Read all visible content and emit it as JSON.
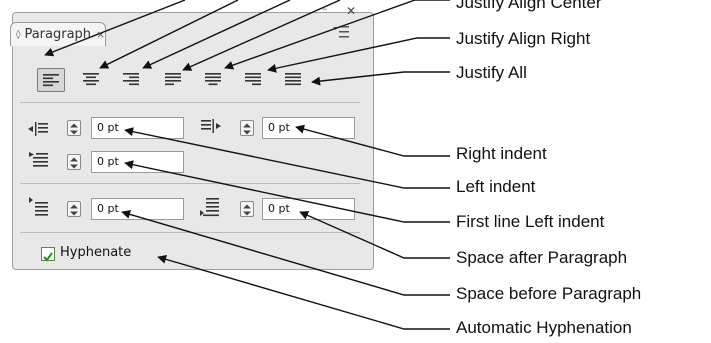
{
  "panel": {
    "tab_label": "Paragraph",
    "tab_close": "×",
    "icons": {
      "tab": "diamond-arrows-icon",
      "close": "close-icon",
      "minimize": "minimize-icon",
      "menu": "panel-menu-icon"
    }
  },
  "alignment": {
    "buttons": [
      {
        "name": "align-left",
        "icon": "align-left-icon",
        "active": true
      },
      {
        "name": "align-center",
        "icon": "align-center-icon",
        "active": false
      },
      {
        "name": "align-right",
        "icon": "align-right-icon",
        "active": false
      },
      {
        "name": "justify-align-left",
        "icon": "justify-left-icon",
        "active": false
      },
      {
        "name": "justify-align-center",
        "icon": "justify-center-icon",
        "active": false
      },
      {
        "name": "justify-align-right",
        "icon": "justify-right-icon",
        "active": false
      },
      {
        "name": "justify-all",
        "icon": "justify-all-icon",
        "active": false
      }
    ]
  },
  "fields": {
    "left_indent": "0 pt",
    "right_indent": "0 pt",
    "first_line_indent": "0 pt",
    "space_before": "0 pt",
    "space_after": "0 pt"
  },
  "hyphenate": {
    "label": "Hyphenate",
    "checked": true
  },
  "callouts": {
    "justify_align_center": "Justify Align Center",
    "justify_align_right": "Justify Align Right",
    "justify_all": "Justify All",
    "right_indent": "Right indent",
    "left_indent": "Left indent",
    "first_line_left_indent": "First line Left indent",
    "space_after_paragraph": "Space after Paragraph",
    "space_before_paragraph": "Space before Paragraph",
    "automatic_hyphenation": "Automatic Hyphenation"
  },
  "colors": {
    "panel_bg": "#e8e8e8",
    "checkbox_check": "#2a8a2a"
  }
}
